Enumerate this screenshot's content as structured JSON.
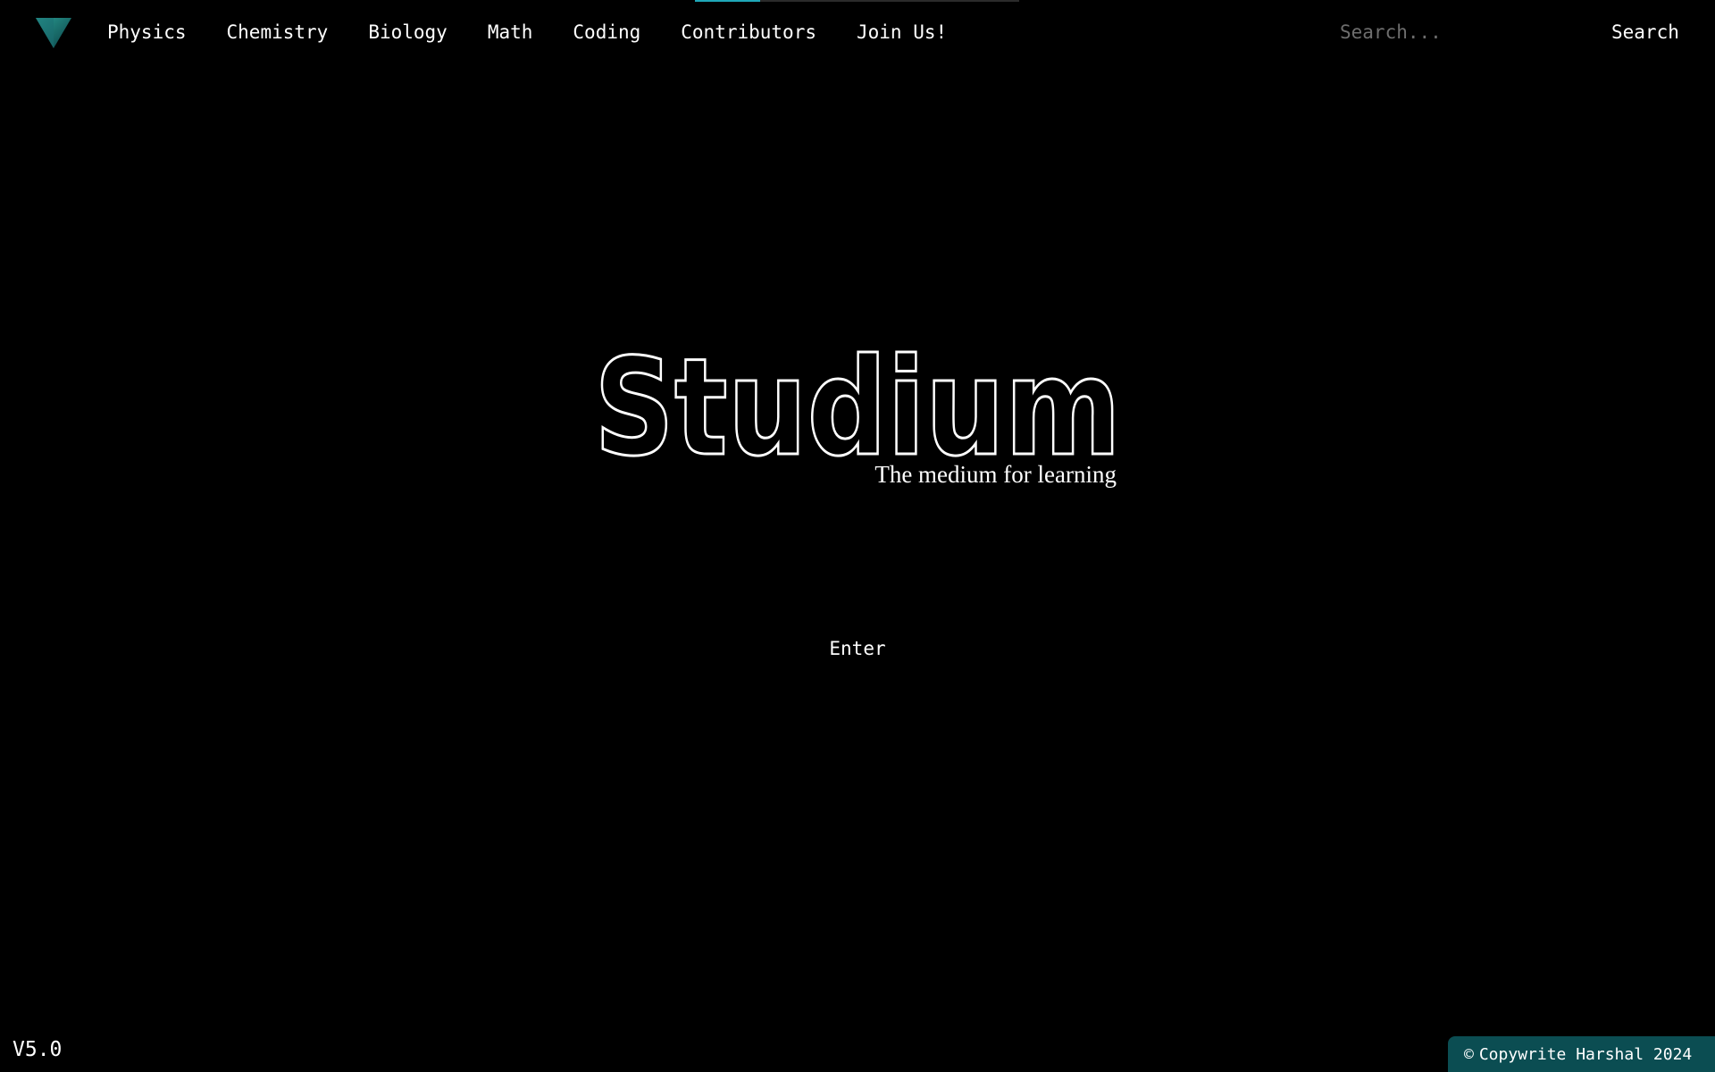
{
  "nav": {
    "links": [
      "Physics",
      "Chemistry",
      "Biology",
      "Math",
      "Coding",
      "Contributors",
      "Join Us!"
    ],
    "search_placeholder": "Search...",
    "search_label": "Search"
  },
  "hero": {
    "title": "Studium",
    "subtitle": "The medium for learning",
    "enter_label": "Enter"
  },
  "footer": {
    "version": "V5.0",
    "copyright_symbol": "©",
    "copyright_text": "Copywrite Harshal 2024"
  },
  "icons": {
    "logo": "triangle-logo-icon"
  },
  "colors": {
    "background": "#000000",
    "accent": "#1fa7b8",
    "footer_badge": "#0b4d52",
    "logo_light": "#2a9d93",
    "logo_dark": "#0a3f44"
  }
}
